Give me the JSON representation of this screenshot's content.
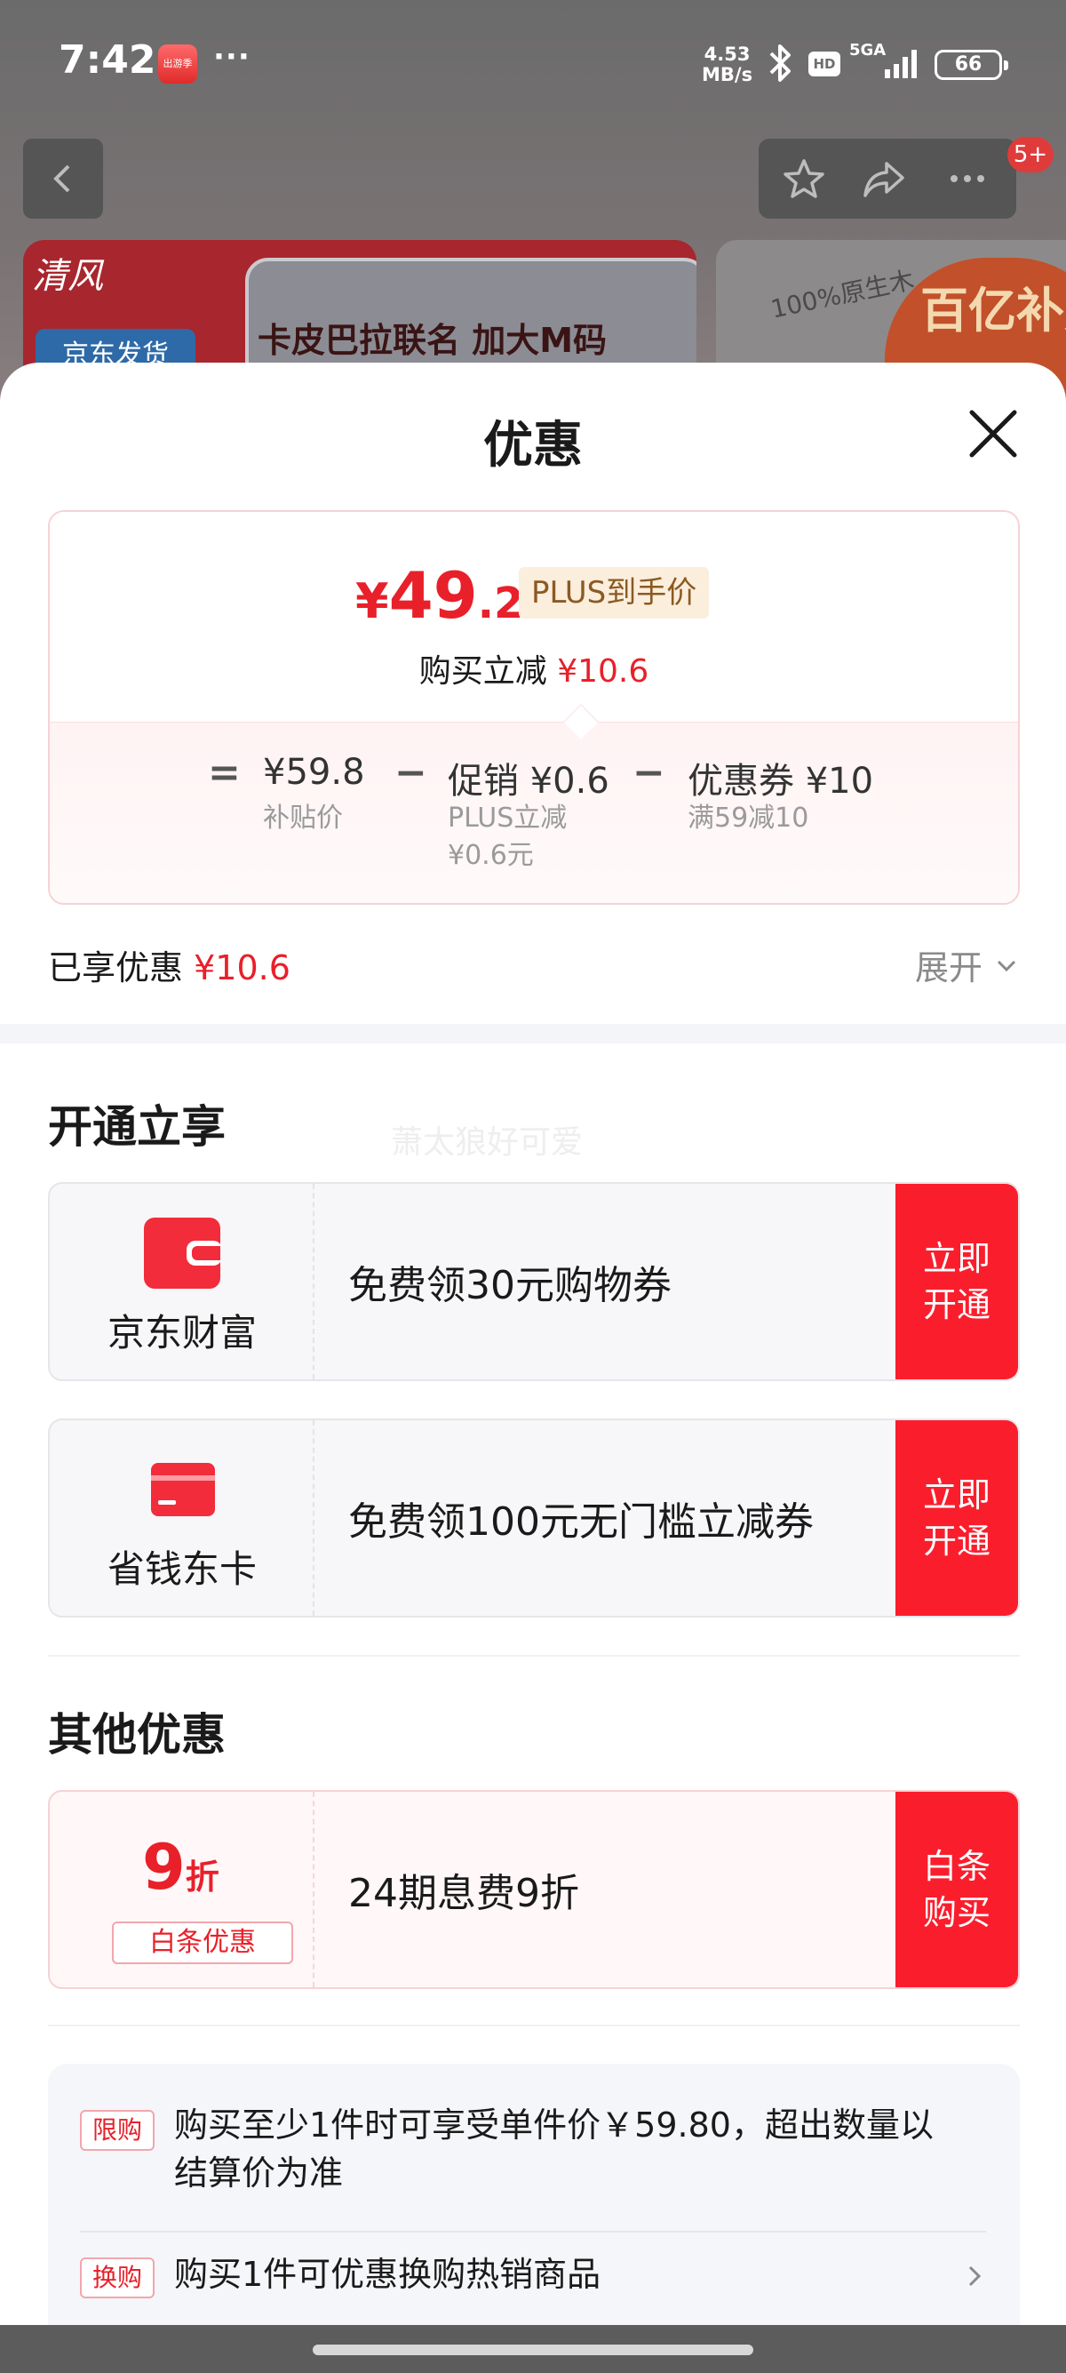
{
  "status_bar": {
    "time": "7:42",
    "dots": "···",
    "app_icon_text": "出游季",
    "net_speed_value": "4.53",
    "net_speed_unit": "MB/s",
    "hd": "HD",
    "network": "5GA",
    "battery": "66"
  },
  "header": {
    "badge": "5+"
  },
  "banner": {
    "brand": "清风",
    "title": "卡皮巴拉联名 加大M码",
    "tag": "京东发货",
    "right_text": "100%原生木",
    "right_badge": "百亿补贴"
  },
  "sheet": {
    "title": "优惠",
    "price": {
      "currency": "¥",
      "integer": "49",
      "decimal": ".2",
      "plus_label": "PLUS到手价",
      "reduce_label": "购买立减",
      "reduce_value": "¥10.6"
    },
    "calculation": {
      "equals": "=",
      "minus": "−",
      "base_price": "¥59.8",
      "base_label": "补贴价",
      "promo_label": "促销",
      "promo_value": "¥0.6",
      "promo_sub_1": "PLUS立减",
      "promo_sub_2": "¥0.6元",
      "coupon_label": "优惠券",
      "coupon_value": "¥10",
      "coupon_sub": "满59减10"
    },
    "enjoyed_label": "已享优惠",
    "enjoyed_value": "¥10.6",
    "expand_label": "展开",
    "section_open": "开通立享",
    "watermark": "萧太狼好可爱",
    "offers_open": [
      {
        "name": "京东财富",
        "desc": "免费领30元购物券",
        "button": "立即开通",
        "icon": "wallet-icon"
      },
      {
        "name": "省钱东卡",
        "desc": "免费领100元无门槛立减券",
        "button": "立即开通",
        "icon": "card-icon"
      }
    ],
    "section_other": "其他优惠",
    "discount": {
      "number": "9",
      "unit": "折",
      "tag": "白条优惠",
      "desc": "24期息费9折",
      "button": "白条购买"
    },
    "rules": [
      {
        "tag": "限购",
        "text": "购买至少1件时可享受单件价￥59.80，超出数量以结算价为准"
      },
      {
        "tag": "换购",
        "text": "购买1件可优惠换购热销商品"
      }
    ]
  },
  "colors": {
    "accent_red": "#fa1e2d",
    "price_red": "#e8202a",
    "plus_bg": "#fbeedd"
  }
}
